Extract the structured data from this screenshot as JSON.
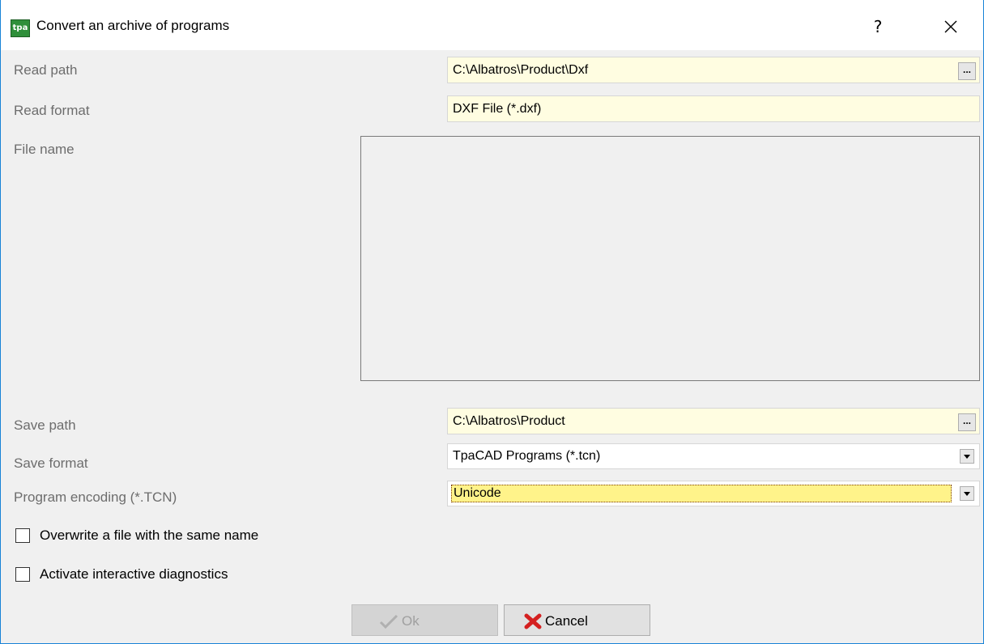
{
  "window": {
    "title": "Convert an archive of programs",
    "help": "?",
    "app_icon_text": "tpa"
  },
  "form": {
    "read_path_label": "Read path",
    "read_path_value": "C:\\Albatros\\Product\\Dxf",
    "read_format_label": "Read format",
    "read_format_value": "DXF File (*.dxf)",
    "file_name_label": "File name",
    "save_path_label": "Save path",
    "save_path_value": "C:\\Albatros\\Product",
    "save_format_label": "Save format",
    "save_format_value": "TpaCAD Programs (*.tcn)",
    "encoding_label": "Program encoding (*.TCN)",
    "encoding_value": "Unicode",
    "browse_label": "...",
    "overwrite_label": "Overwrite a file with the same name",
    "overwrite_checked": false,
    "diagnostics_label": "Activate interactive diagnostics",
    "diagnostics_checked": false
  },
  "buttons": {
    "ok_label": "Ok",
    "ok_enabled": false,
    "cancel_label": "Cancel"
  },
  "colors": {
    "field_bg": "#fffde1",
    "accent_border": "#1883d7",
    "cancel_icon": "#d42020"
  },
  "icons": [
    "app-icon",
    "help-icon",
    "close-icon",
    "browse-icon",
    "chevron-down-icon",
    "checkmark-icon",
    "cancel-x-icon"
  ]
}
